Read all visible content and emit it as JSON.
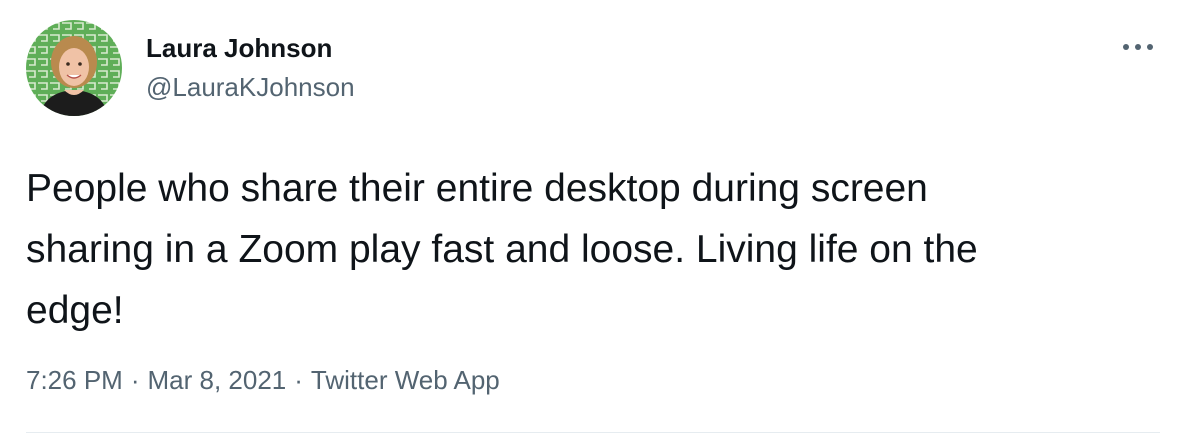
{
  "author": {
    "display_name": "Laura Johnson",
    "handle": "@LauraKJohnson",
    "avatar_icon": "profile-photo"
  },
  "more_icon": "ellipsis-icon",
  "tweet": {
    "text": "People who share their entire desktop during screen\nsharing in a Zoom play fast and loose. Living life on the\nedge!"
  },
  "meta": {
    "time": "7:26 PM",
    "date": "Mar 8, 2021",
    "source": "Twitter Web App",
    "separator": "·"
  },
  "colors": {
    "text_primary": "#0f1419",
    "text_secondary": "#536471",
    "divider": "#e6ecf0"
  }
}
